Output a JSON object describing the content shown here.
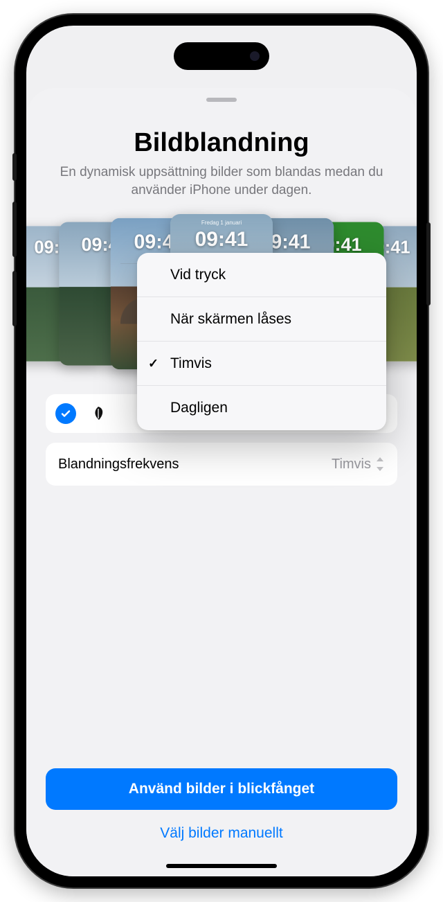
{
  "header": {
    "title": "Bildblandning",
    "subtitle": "En dynamisk uppsättning bilder som blandas medan du använder iPhone under dagen."
  },
  "previews": {
    "date_label": "Fredag 1 januari",
    "times": [
      "09:41",
      "09:41",
      "09:41",
      "09:41",
      "09:41",
      "09:41",
      "09:41"
    ]
  },
  "frequency_popover": {
    "items": [
      {
        "label": "Vid tryck",
        "selected": false
      },
      {
        "label": "När skärmen låses",
        "selected": false
      },
      {
        "label": "Timvis",
        "selected": true
      },
      {
        "label": "Dagligen",
        "selected": false
      }
    ]
  },
  "frequency_row": {
    "label": "Blandningsfrekvens",
    "value": "Timvis"
  },
  "buttons": {
    "primary": "Använd bilder i blickfånget",
    "secondary": "Välj bilder manuellt"
  }
}
